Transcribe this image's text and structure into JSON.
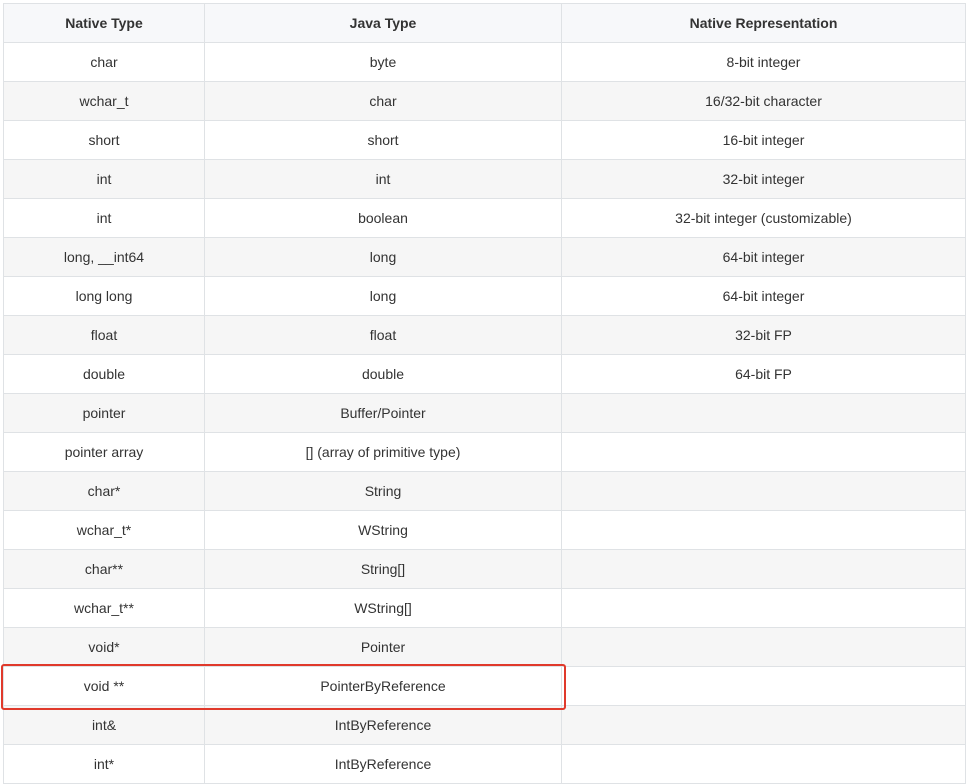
{
  "table": {
    "headers": [
      "Native Type",
      "Java Type",
      "Native Representation"
    ],
    "rows": [
      [
        "char",
        "byte",
        "8-bit integer"
      ],
      [
        "wchar_t",
        "char",
        "16/32-bit character"
      ],
      [
        "short",
        "short",
        "16-bit integer"
      ],
      [
        "int",
        "int",
        "32-bit integer"
      ],
      [
        "int",
        "boolean",
        "32-bit integer (customizable)"
      ],
      [
        "long, __int64",
        "long",
        "64-bit integer"
      ],
      [
        "long long",
        "long",
        "64-bit integer"
      ],
      [
        "float",
        "float",
        "32-bit FP"
      ],
      [
        "double",
        "double",
        "64-bit FP"
      ],
      [
        "pointer",
        "Buffer/Pointer",
        ""
      ],
      [
        "pointer array",
        "[] (array of primitive type)",
        ""
      ],
      [
        "char*",
        "String",
        ""
      ],
      [
        "wchar_t*",
        "WString",
        ""
      ],
      [
        "char**",
        "String[]",
        ""
      ],
      [
        "wchar_t**",
        "WString[]",
        ""
      ],
      [
        "void*",
        "Pointer",
        ""
      ],
      [
        "void **",
        "PointerByReference",
        ""
      ],
      [
        "int&",
        "IntByReference",
        ""
      ],
      [
        "int*",
        "IntByReference",
        ""
      ]
    ]
  },
  "highlight": {
    "row_index": 16,
    "color": "#e0392b"
  }
}
